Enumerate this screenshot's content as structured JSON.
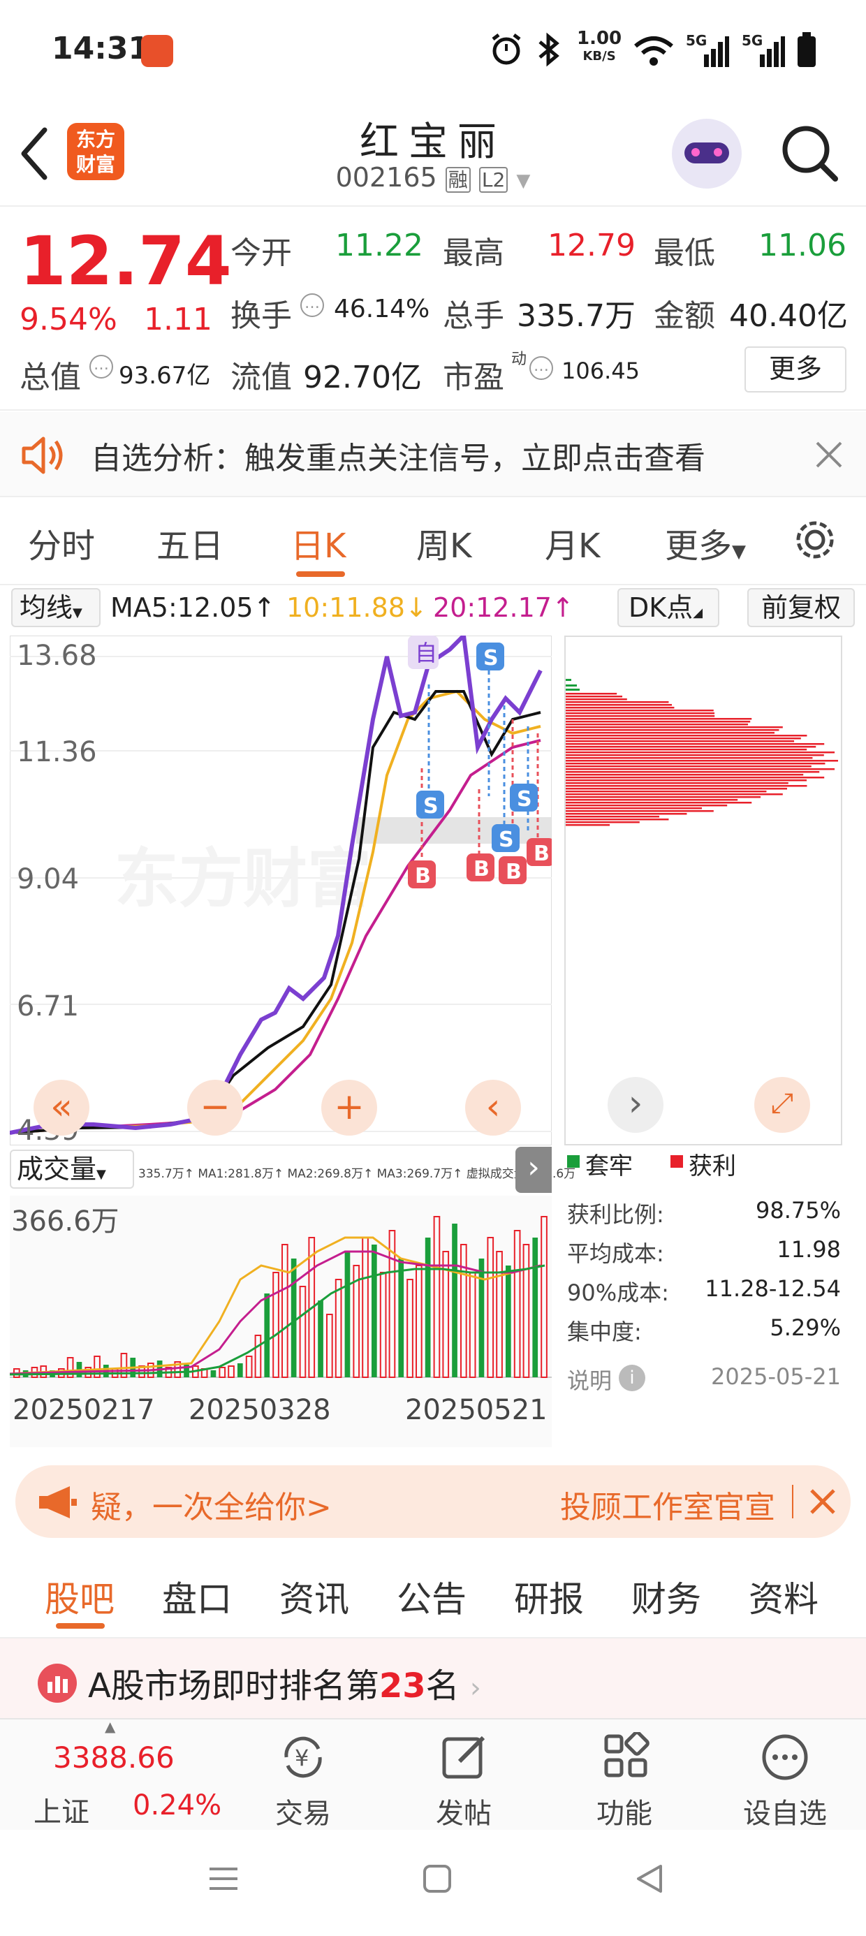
{
  "status_bar": {
    "time": "14:31",
    "speed_value": "1.00",
    "speed_unit": "KB/S",
    "net1": "5G",
    "net2": "5G"
  },
  "header": {
    "title": "红宝丽",
    "code": "002165",
    "tag1": "融",
    "tag2": "L2"
  },
  "quote": {
    "price": "12.74",
    "change_pct": "9.54%",
    "change": "1.11",
    "open_label": "今开",
    "open": "11.22",
    "high_label": "最高",
    "high": "12.79",
    "low_label": "最低",
    "low": "11.06",
    "turnover_label": "换手",
    "turnover": "46.14%",
    "volume_label": "总手",
    "volume": "335.7万",
    "amount_label": "金额",
    "amount": "40.40亿",
    "mktcap_label": "总值",
    "mktcap": "93.67亿",
    "float_label": "流值",
    "float": "92.70亿",
    "pe_label": "市盈",
    "pe_sup": "动",
    "pe": "106.45",
    "more_button": "更多"
  },
  "notice": {
    "text": "自选分析：触发重点关注信号，立即点击查看"
  },
  "period_tabs": [
    "分时",
    "五日",
    "日K",
    "周K",
    "月K",
    "更多"
  ],
  "active_tab": 2,
  "ma_bar": {
    "ma_select": "均线",
    "ma5": "MA5:12.05↑",
    "ma10": "10:11.88↓",
    "ma20": "20:12.17↑",
    "dk_button": "DK点",
    "adjust_button": "前复权"
  },
  "kline": {
    "y_ticks": [
      "13.68",
      "11.36",
      "9.04",
      "6.71",
      "4.39"
    ],
    "markers": {
      "self": "自",
      "s": "S",
      "b": "B"
    },
    "watermark": "东方财富"
  },
  "volume": {
    "select": "成交量",
    "legend": "335.7万↑ MA1:281.8万↑ MA2:269.8万↑ MA3:269.7万↑ 虚拟成交量:366.6万",
    "max_label": "366.6万",
    "dates": [
      "20250217",
      "20250328",
      "20250521"
    ]
  },
  "chip": {
    "legend_trapped": "套牢",
    "legend_profit": "获利",
    "rows": [
      {
        "label": "获利比例:",
        "value": "98.75%"
      },
      {
        "label": "平均成本:",
        "value": "11.98"
      },
      {
        "label": "90%成本:",
        "value": "11.28-12.54"
      },
      {
        "label": "集中度:",
        "value": "5.29%"
      }
    ],
    "note_label": "说明",
    "date": "2025-05-21"
  },
  "banner": {
    "text": "疑，一次全给你>",
    "right": "投顾工作室官宣"
  },
  "sub_tabs": [
    "股吧",
    "盘口",
    "资讯",
    "公告",
    "研报",
    "财务",
    "资料"
  ],
  "rank": {
    "prefix": "A股市场即时排名第",
    "number": "23",
    "suffix": "名"
  },
  "bottom_bar": {
    "index_value": "3388.66",
    "index_name": "上证",
    "index_change": "0.24%",
    "items": [
      "交易",
      "发帖",
      "功能",
      "设自选"
    ]
  },
  "colors": {
    "up": "#e8202a",
    "down": "#1a9e3b",
    "accent": "#e8692a",
    "ma5": "#7b3fd0",
    "ma10": "#f0b020",
    "ma20": "#c41e8e"
  }
}
